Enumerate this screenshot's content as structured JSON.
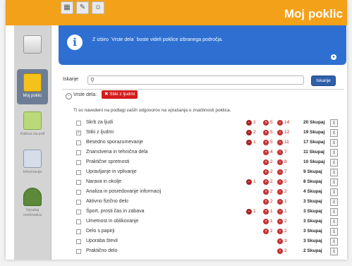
{
  "topbar": {
    "title": "Moj poklic",
    "icons": [
      "grid-icon",
      "edit-icon",
      "people-icon"
    ]
  },
  "sidebar": {
    "items": [
      {
        "label": "",
        "icon": "document-icon"
      },
      {
        "label": "Moj poklic",
        "icon": "job-icon"
      },
      {
        "label": "Kaktus na poti",
        "icon": "map-icon"
      },
      {
        "label": "Informacije",
        "icon": "info-doc-icon"
      },
      {
        "label": "Vprašaj svetovalca",
        "icon": "counselor-icon"
      }
    ]
  },
  "info": {
    "message": "Z izbiro `Vrste dela` boste videli poklice izbranega področja."
  },
  "search": {
    "label": "Iskanje",
    "placeholder": "",
    "value": "",
    "button": "Iskanje"
  },
  "filter": {
    "label": "Vrste dela:",
    "toggle": "−",
    "tag_close": "✖",
    "tag": "Stiki z ljudmi"
  },
  "note": "Ti so navedeni na podlagi vaših odgovorov na vprašanja o značilnosti poklica.",
  "info_button_glyph": "i",
  "colors": {
    "accent": "#f4a11a",
    "info": "#2e6fd1",
    "alert": "#d41c1c"
  },
  "items": [
    {
      "name": "Skrb za ljudi",
      "checked": false,
      "c1": "1",
      "c2": "5",
      "c3": "14",
      "total": "20 Skupaj"
    },
    {
      "name": "Stiki z ljudmi",
      "checked": true,
      "c1": "2",
      "c2": "5",
      "c3": "12",
      "total": "19 Skupaj"
    },
    {
      "name": "Besedno sporazumevanje",
      "checked": false,
      "c1": "1",
      "c2": "5",
      "c3": "11",
      "total": "17 Skupaj"
    },
    {
      "name": "Znanstvena in tehnična dela",
      "checked": false,
      "c1": "",
      "c2": "4",
      "c3": "7",
      "total": "11 Skupaj"
    },
    {
      "name": "Praktične spretnosti",
      "checked": false,
      "c1": "",
      "c2": "2",
      "c3": "8",
      "total": "10 Skupaj"
    },
    {
      "name": "Upravljanje in vplivanje",
      "checked": false,
      "c1": "",
      "c2": "2",
      "c3": "7",
      "total": "9 Skupaj"
    },
    {
      "name": "Narava in okolje",
      "checked": false,
      "c1": "1",
      "c2": "2",
      "c3": "5",
      "total": "8 Skupaj"
    },
    {
      "name": "Analiza in posredovanje informacij",
      "checked": false,
      "c1": "",
      "c2": "2",
      "c3": "2",
      "total": "4 Skupaj"
    },
    {
      "name": "Aktivno fizično delo",
      "checked": false,
      "c1": "",
      "c2": "2",
      "c3": "1",
      "total": "3 Skupaj"
    },
    {
      "name": "Šport, prosti čas in zabava",
      "checked": false,
      "c1": "1",
      "c2": "1",
      "c3": "1",
      "total": "3 Skupaj"
    },
    {
      "name": "Umetnost in oblikovanje",
      "checked": false,
      "c1": "",
      "c2": "1",
      "c3": "2",
      "total": "3 Skupaj"
    },
    {
      "name": "Delo s papirji",
      "checked": false,
      "c1": "",
      "c2": "1",
      "c3": "2",
      "total": "3 Skupaj"
    },
    {
      "name": "Uporaba števil",
      "checked": false,
      "c1": "",
      "c2": "",
      "c3": "3",
      "total": "3 Skupaj"
    },
    {
      "name": "Praktično delo",
      "checked": false,
      "c1": "",
      "c2": "",
      "c3": "2",
      "total": "2 Skupaj"
    }
  ]
}
